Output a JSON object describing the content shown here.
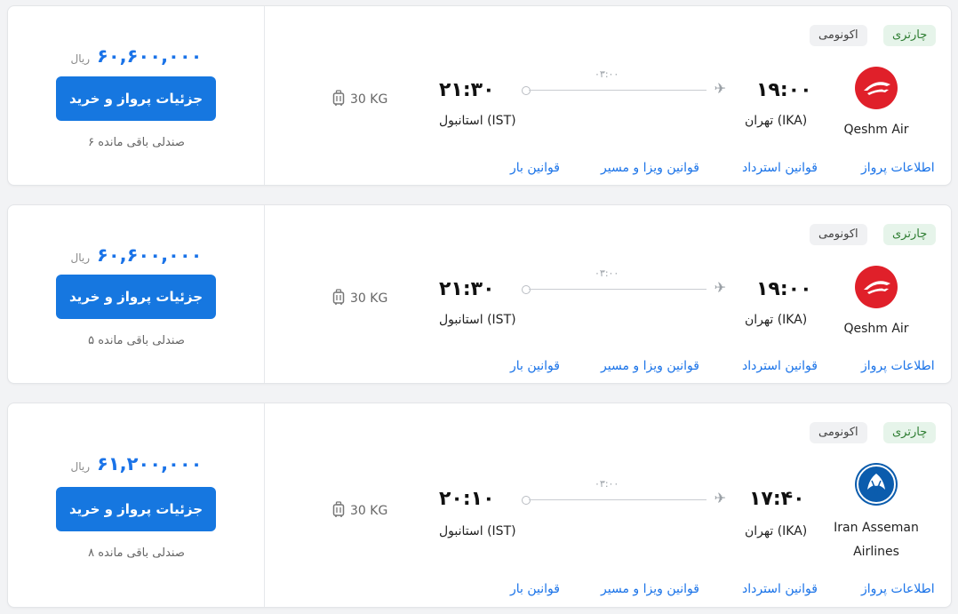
{
  "labels": {
    "buy_button": "جزئیات پرواز و خرید",
    "currency": "ریال",
    "badge_charter": "چارتری",
    "badge_class": "اکونومی",
    "duration": "۰۳:۰۰",
    "origin": "تهران (IKA)",
    "destination": "استانبول (IST)",
    "baggage": "30 KG",
    "link_flight_info": "اطلاعات پرواز",
    "link_refund": "قوانین استرداد",
    "link_visa": "قوانین ویزا و مسیر",
    "link_baggage": "قوانین بار"
  },
  "flights": [
    {
      "price": "۶۰,۶۰۰,۰۰۰",
      "seats": "۶ صندلی باقی مانده",
      "departure_time": "۱۹:۰۰",
      "arrival_time": "۲۱:۳۰",
      "airline": "Qeshm Air",
      "airline_line2": "",
      "logo_color": "#e0202a"
    },
    {
      "price": "۶۰,۶۰۰,۰۰۰",
      "seats": "۵ صندلی باقی مانده",
      "departure_time": "۱۹:۰۰",
      "arrival_time": "۲۱:۳۰",
      "airline": "Qeshm Air",
      "airline_line2": "",
      "logo_color": "#e0202a"
    },
    {
      "price": "۶۱,۲۰۰,۰۰۰",
      "seats": "۸ صندلی باقی مانده",
      "departure_time": "۱۷:۴۰",
      "arrival_time": "۲۰:۱۰",
      "airline": "Iran Asseman",
      "airline_line2": "Airlines",
      "logo_color": "#0b5cad"
    }
  ],
  "icons": {
    "plane": "airplane-icon",
    "baggage": "suitcase-icon",
    "logo_qeshm": "qeshm-air-logo",
    "logo_asseman": "iran-asseman-logo"
  },
  "colors": {
    "accent": "#1677e0",
    "charter_bg": "#e6f4ea",
    "charter_text": "#2e7d32"
  }
}
